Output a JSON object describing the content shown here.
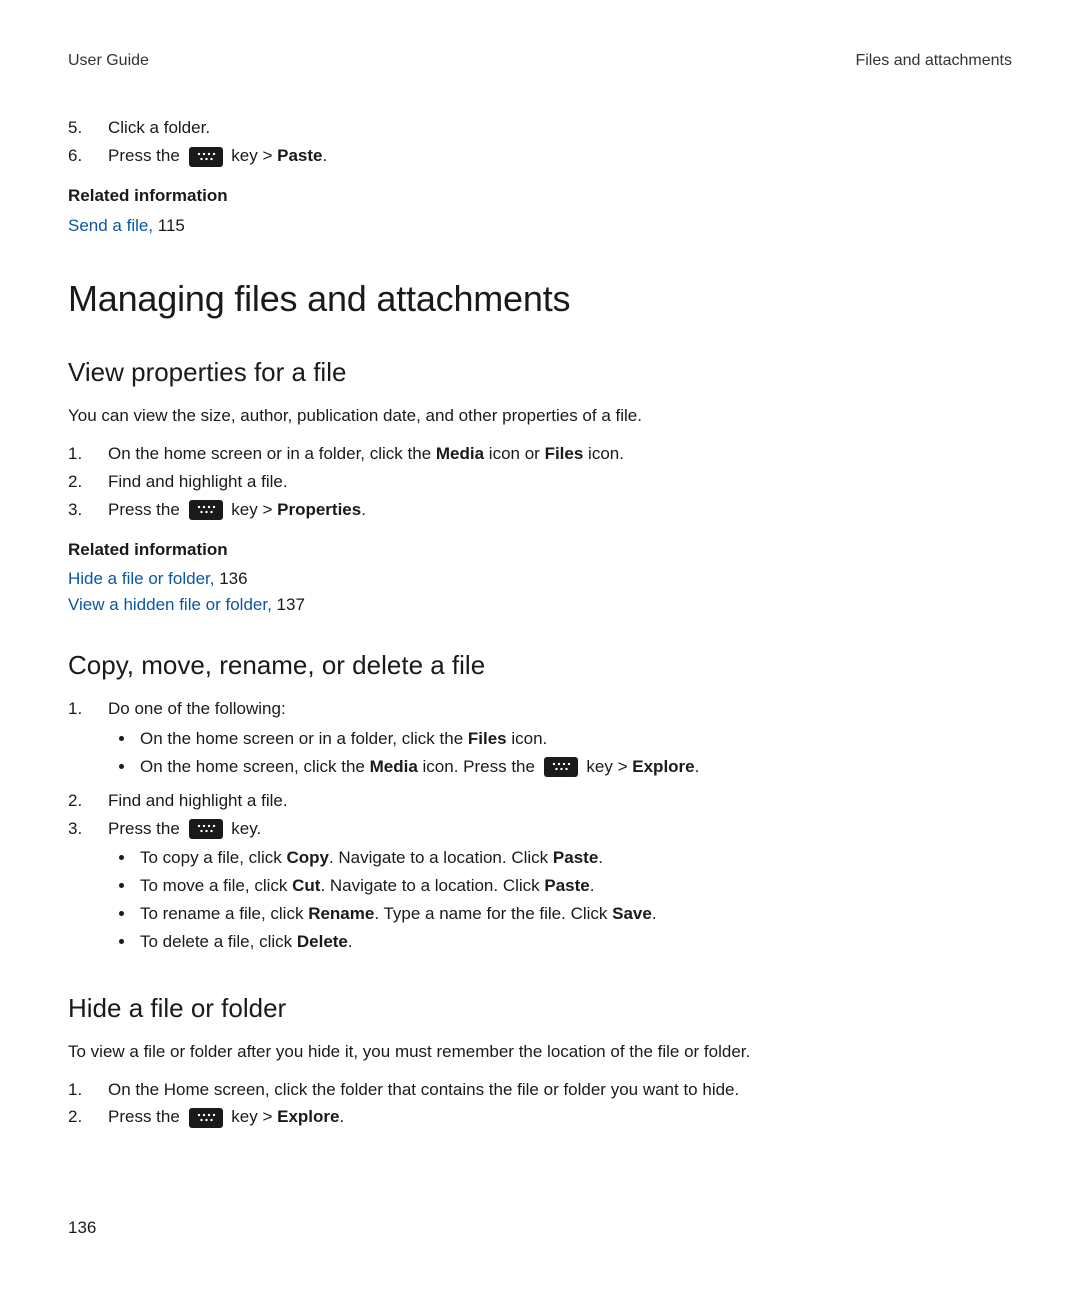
{
  "header": {
    "left": "User Guide",
    "right": "Files and attachments"
  },
  "intro_steps": [
    {
      "num": "5.",
      "text": "Click a folder."
    },
    {
      "num": "6.",
      "pre": "Press the ",
      "post_key": " key > ",
      "bold": "Paste",
      "tail": "."
    }
  ],
  "related1": {
    "heading": "Related information",
    "items": [
      {
        "link": "Send a file,",
        "page": " 115"
      }
    ]
  },
  "h1": "Managing files and attachments",
  "section_view": {
    "title": "View properties for a file",
    "desc": "You can view the size, author, publication date, and other properties of a file.",
    "steps": [
      {
        "num": "1.",
        "pre": "On the home screen or in a folder, click the ",
        "b1": "Media",
        "mid": " icon or ",
        "b2": "Files",
        "tail": " icon."
      },
      {
        "num": "2.",
        "text": "Find and highlight a file."
      },
      {
        "num": "3.",
        "pre": "Press the ",
        "post_key": " key > ",
        "bold": "Properties",
        "tail": "."
      }
    ],
    "related": {
      "heading": "Related information",
      "items": [
        {
          "link": "Hide a file or folder,",
          "page": " 136"
        },
        {
          "link": "View a hidden file or folder,",
          "page": " 137"
        }
      ]
    }
  },
  "section_copy": {
    "title": "Copy, move, rename, or delete a file",
    "step1": {
      "num": "1.",
      "text": "Do one of the following:",
      "bullets": [
        {
          "pre": "On the home screen or in a folder, click the ",
          "b1": "Files",
          "tail": " icon."
        },
        {
          "pre": "On the home screen, click the ",
          "b1": "Media",
          "mid": " icon. Press the ",
          "post_key": " key > ",
          "b2": "Explore",
          "tail": "."
        }
      ]
    },
    "step2": {
      "num": "2.",
      "text": "Find and highlight a file."
    },
    "step3": {
      "num": "3.",
      "pre": "Press the ",
      "post_key": " key.",
      "bullets": [
        {
          "pre": "To copy a file, click ",
          "b1": "Copy",
          "mid": ". Navigate to a location. Click ",
          "b2": "Paste",
          "tail": "."
        },
        {
          "pre": "To move a file, click ",
          "b1": "Cut",
          "mid": ". Navigate to a location. Click ",
          "b2": "Paste",
          "tail": "."
        },
        {
          "pre": "To rename a file, click ",
          "b1": "Rename",
          "mid": ". Type a name for the file. Click ",
          "b2": "Save",
          "tail": "."
        },
        {
          "pre": "To delete a file, click ",
          "b1": "Delete",
          "tail": "."
        }
      ]
    }
  },
  "section_hide": {
    "title": "Hide a file or folder",
    "desc": "To view a file or folder after you hide it, you must remember the location of the file or folder.",
    "steps": [
      {
        "num": "1.",
        "text": "On the Home screen, click the folder that contains the file or folder you want to hide."
      },
      {
        "num": "2.",
        "pre": "Press the ",
        "post_key": " key > ",
        "bold": "Explore",
        "tail": "."
      }
    ]
  },
  "page_number": "136"
}
